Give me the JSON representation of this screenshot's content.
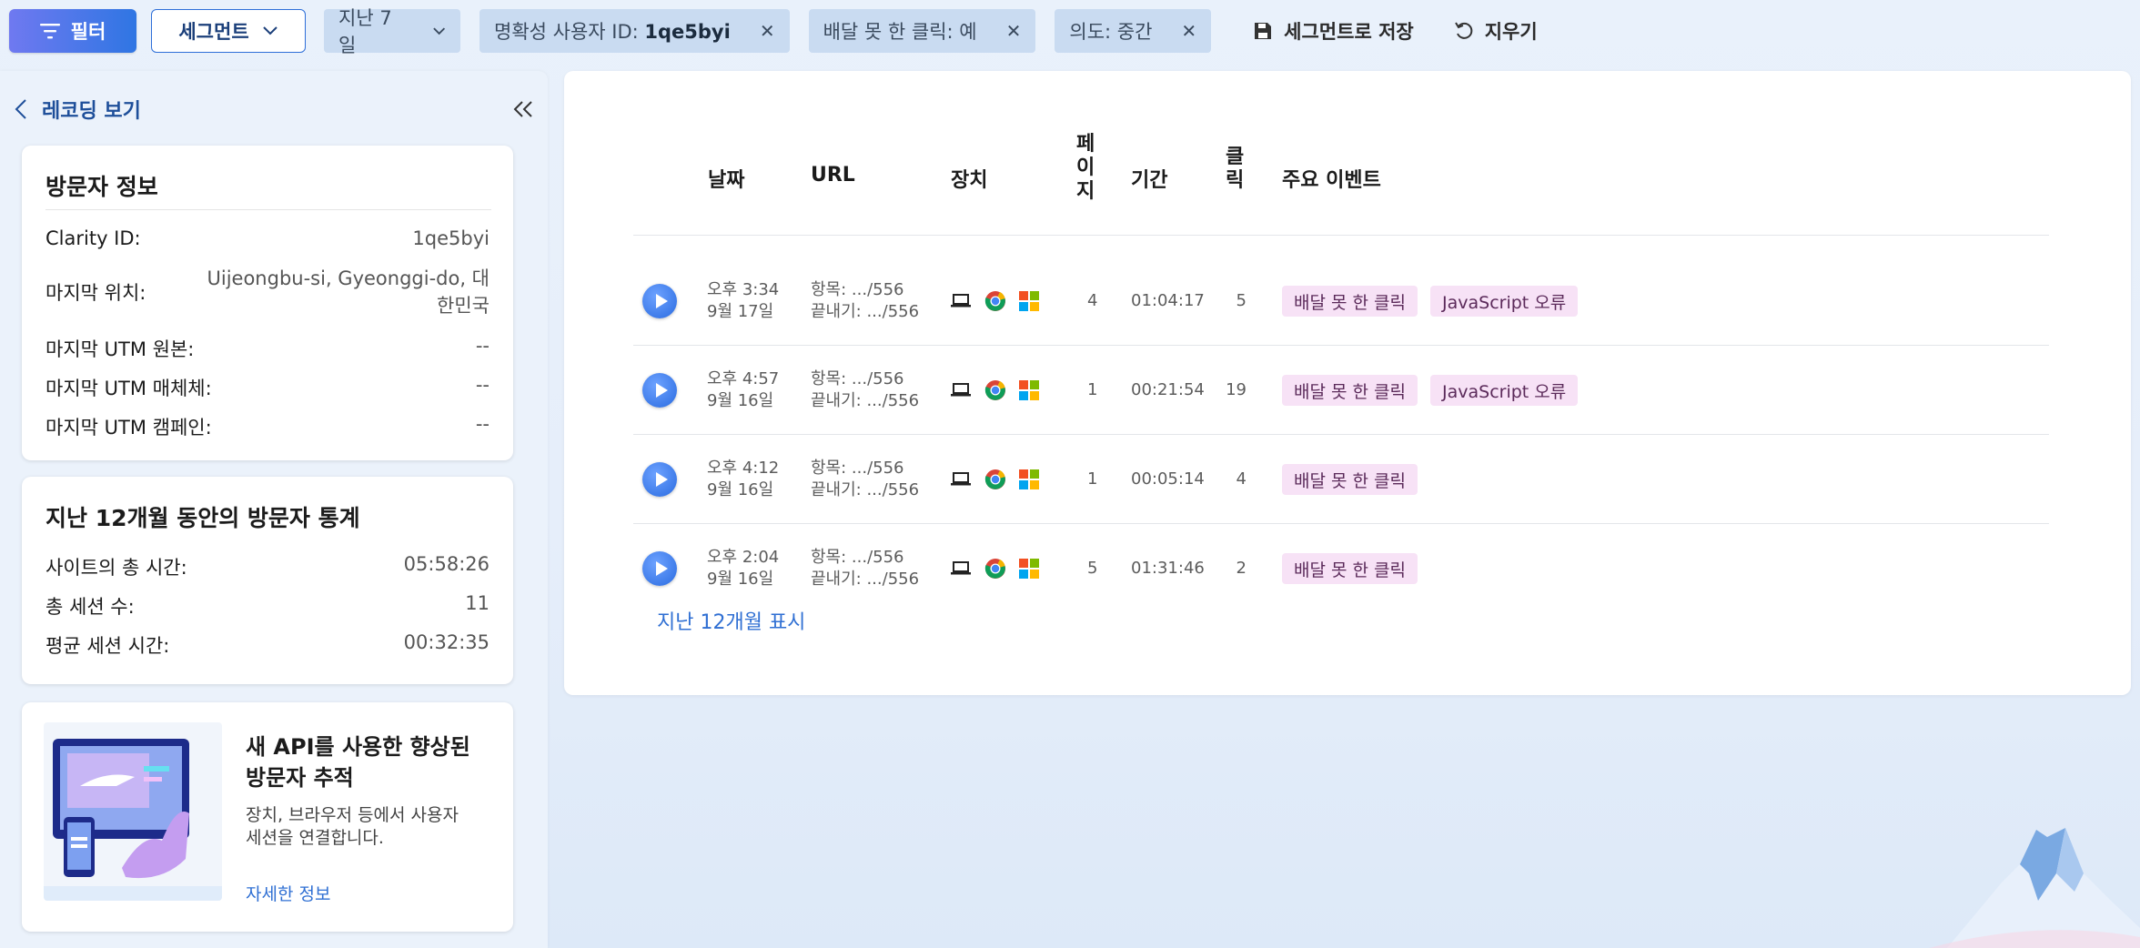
{
  "toolbar": {
    "filter_label": "필터",
    "segment_label": "세그먼트",
    "chips": [
      {
        "text": "지난 7일",
        "dropdown": true
      },
      {
        "label": "명확성 사용자 ID: ",
        "value": "1qe5byi"
      },
      {
        "text": "배달 못 한 클릭: 예"
      },
      {
        "text": "의도: 중간"
      }
    ],
    "save_label": "세그먼트로 저장",
    "clear_label": "지우기"
  },
  "sidebar": {
    "back_label": "레코딩 보기",
    "visitor_info": {
      "title": "방문자 정보",
      "rows": [
        {
          "label": "Clarity ID:",
          "value": "1qe5byi"
        },
        {
          "label": "마지막 위치:",
          "value_line1": "Uijeongbu-si, Gyeonggi-do, 대",
          "value_line2": "한민국"
        },
        {
          "label": "마지막 UTM 원본:",
          "value": "--"
        },
        {
          "label": "마지막 UTM 매체체:",
          "value": "--"
        },
        {
          "label": "마지막 UTM 캠페인:",
          "value": "--"
        }
      ]
    },
    "stats": {
      "title": "지난 12개월 동안의 방문자 통계",
      "rows": [
        {
          "label": "사이트의 총 시간:",
          "value": "05:58:26"
        },
        {
          "label": "총 세션 수:",
          "value": "11"
        },
        {
          "label": "평균 세션 시간:",
          "value": "00:32:35"
        }
      ]
    },
    "promo": {
      "title_line1": "새 API를 사용한 향상된",
      "title_line2": "방문자 추적",
      "desc_line1": "장치, 브라우저 등에서 사용자",
      "desc_line2": "세션을 연결합니다.",
      "link": "자세한 정보"
    }
  },
  "table": {
    "headers": {
      "date": "날짜",
      "url": "URL",
      "device": "장치",
      "pages": [
        "페",
        "이",
        "지"
      ],
      "duration": "기간",
      "clicks": [
        "클",
        "릭"
      ],
      "events": "주요 이벤트"
    },
    "rows": [
      {
        "time": "오후 3:34",
        "date": "9월 17일",
        "entry": "항목: .../556",
        "exit": "끝내기: .../556",
        "pages": "4",
        "duration": "01:04:17",
        "clicks": "5",
        "events": [
          "배달 못 한 클릭",
          "JavaScript 오류"
        ]
      },
      {
        "time": "오후 4:57",
        "date": "9월 16일",
        "entry": "항목: .../556",
        "exit": "끝내기: .../556",
        "pages": "1",
        "duration": "00:21:54",
        "clicks": "19",
        "events": [
          "배달 못 한 클릭",
          "JavaScript 오류"
        ]
      },
      {
        "time": "오후 4:12",
        "date": "9월 16일",
        "entry": "항목: .../556",
        "exit": "끝내기: .../556",
        "pages": "1",
        "duration": "00:05:14",
        "clicks": "4",
        "events": [
          "배달 못 한 클릭"
        ]
      },
      {
        "time": "오후 2:04",
        "date": "9월 16일",
        "entry": "항목: .../556",
        "exit": "끝내기: .../556",
        "pages": "5",
        "duration": "01:31:46",
        "clicks": "2",
        "events": [
          "배달 못 한 클릭"
        ]
      }
    ],
    "show_more": "지난 12개월 표시"
  },
  "icons": {
    "device": "laptop-icon",
    "browser": "chrome-icon",
    "os": "windows-icon",
    "play": "play-icon"
  },
  "colors": {
    "accent": "#2f76e3",
    "tag_bg": "#f7e2f6",
    "chip_bg": "#c9dbf1"
  }
}
